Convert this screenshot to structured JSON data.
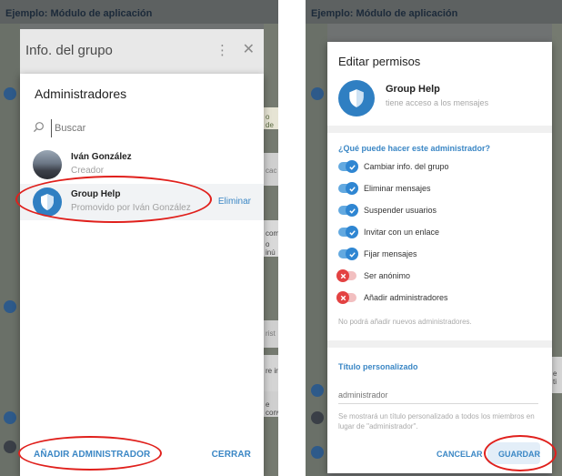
{
  "left_window": {
    "window_title": "Ejemplo: Módulo de aplicación",
    "group_header": {
      "title": "Info. del grupo",
      "more_icon": "⋮",
      "close_icon": "✕"
    },
    "bg_fragments": [
      "o de",
      "cac",
      "com",
      "o inú",
      "rist",
      "re ir",
      "e conv"
    ],
    "admins_dialog": {
      "title": "Administradores",
      "search_placeholder": "Buscar",
      "admins": [
        {
          "name": "Iván González",
          "role": "Creador",
          "avatar": "photo"
        },
        {
          "name": "Group Help",
          "role": "Promovido por Iván González",
          "avatar": "shield",
          "action": "Eliminar",
          "selected": true
        }
      ],
      "add_admin_label": "AÑADIR ADMINISTRADOR",
      "close_label": "CERRAR"
    }
  },
  "right_window": {
    "window_title": "Ejemplo: Módulo de aplicación",
    "bg_fragments": [
      "e ti"
    ],
    "perm_dialog": {
      "title": "Editar permisos",
      "bot_name": "Group Help",
      "bot_status": "tiene acceso a los mensajes",
      "permissions_title": "¿Qué puede hacer este administrador?",
      "permissions": [
        {
          "label": "Cambiar info. del grupo",
          "enabled": true
        },
        {
          "label": "Eliminar mensajes",
          "enabled": true
        },
        {
          "label": "Suspender usuarios",
          "enabled": true
        },
        {
          "label": "Invitar con un enlace",
          "enabled": true
        },
        {
          "label": "Fijar mensajes",
          "enabled": true
        },
        {
          "label": "Ser anónimo",
          "enabled": false
        },
        {
          "label": "Añadir administradores",
          "enabled": false
        }
      ],
      "permissions_note": "No podrá añadir nuevos administradores.",
      "custom_title_heading": "Título personalizado",
      "custom_title_placeholder": "administrador",
      "custom_title_help": "Se mostrará un título personalizado a todos los miembros en lugar de \"administrador\".",
      "cancel_label": "CANCELAR",
      "save_label": "GUARDAR"
    }
  },
  "colors": {
    "accent": "#3b87c5",
    "toggle_on": "#2f86d2",
    "toggle_off": "#e34242",
    "annotation": "#e0201c"
  }
}
